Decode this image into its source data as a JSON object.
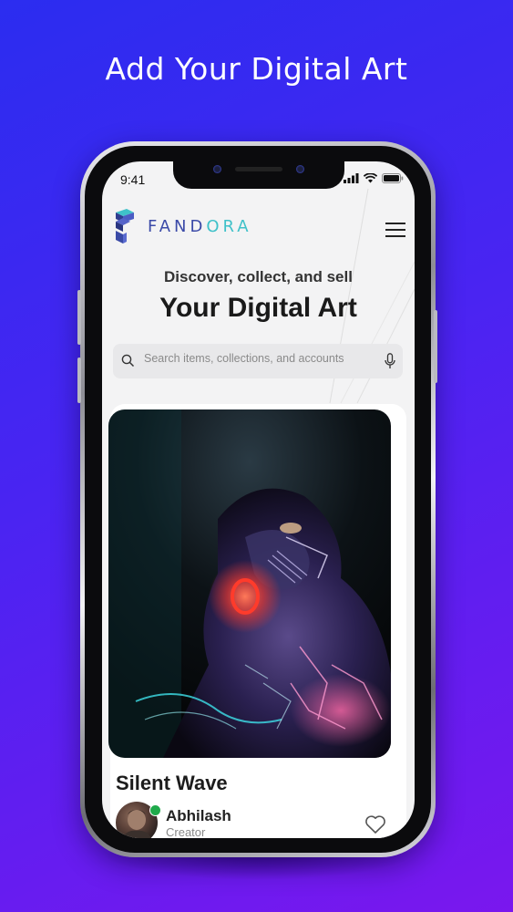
{
  "promo": {
    "title": "Add Your Digital Art"
  },
  "status_bar": {
    "time": "9:41"
  },
  "header": {
    "brand_primary": "FAND",
    "brand_accent": "ORA"
  },
  "hero": {
    "subtitle": "Discover, collect, and sell",
    "headline": "Your Digital Art"
  },
  "search": {
    "placeholder": "Search items, collections, and accounts"
  },
  "featured": {
    "title": "Silent Wave",
    "creator_name": "Abhilash",
    "creator_role": "Creator"
  },
  "colors": {
    "brand_dark": "#3b4aa8",
    "brand_accent": "#3fc1c9",
    "online": "#1faa4b",
    "background_start": "#2b2df0",
    "background_end": "#7a17ee"
  },
  "icons": [
    "logo-icon",
    "menu-icon",
    "search-icon",
    "mic-icon",
    "heart-icon",
    "signal-icon",
    "wifi-icon",
    "battery-icon"
  ]
}
